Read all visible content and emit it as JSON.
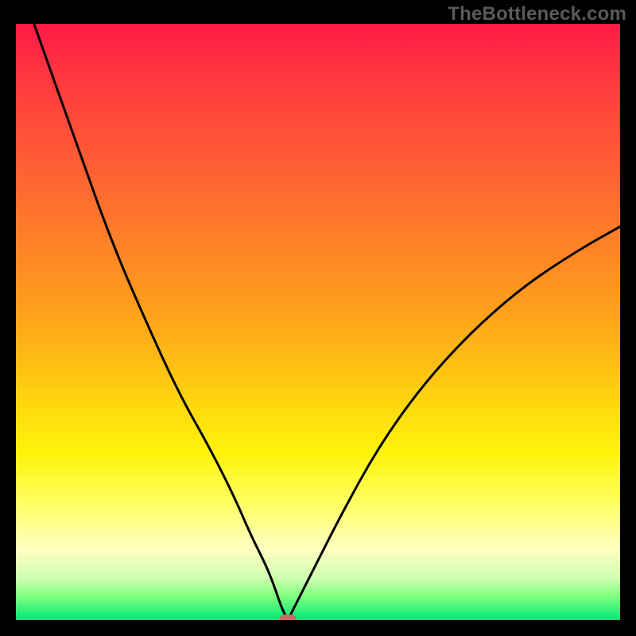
{
  "watermark": "TheBottleneck.com",
  "chart_data": {
    "type": "line",
    "title": "",
    "xlabel": "",
    "ylabel": "",
    "xlim": [
      0,
      100
    ],
    "ylim": [
      0,
      100
    ],
    "grid": false,
    "series": [
      {
        "name": "bottleneck-curve",
        "x": [
          3,
          10,
          16,
          22,
          27,
          32,
          36,
          39,
          41.5,
          43,
          44,
          45,
          46,
          49,
          54,
          60,
          67,
          75,
          84,
          93,
          100
        ],
        "values": [
          100,
          80,
          63,
          49,
          38,
          29,
          21,
          14,
          9,
          5,
          2,
          0,
          2,
          8,
          18,
          29,
          39,
          48,
          56,
          62,
          66
        ]
      }
    ],
    "annotations": [
      {
        "name": "optimum-marker",
        "x": 45,
        "y": 0,
        "shape": "rounded-rect",
        "color": "#c96b63"
      }
    ],
    "background_gradient": {
      "stops": [
        {
          "pos": 0,
          "color": "#ff1b46"
        },
        {
          "pos": 50,
          "color": "#ffba14"
        },
        {
          "pos": 80,
          "color": "#ffff60"
        },
        {
          "pos": 100,
          "color": "#00e874"
        }
      ]
    }
  }
}
